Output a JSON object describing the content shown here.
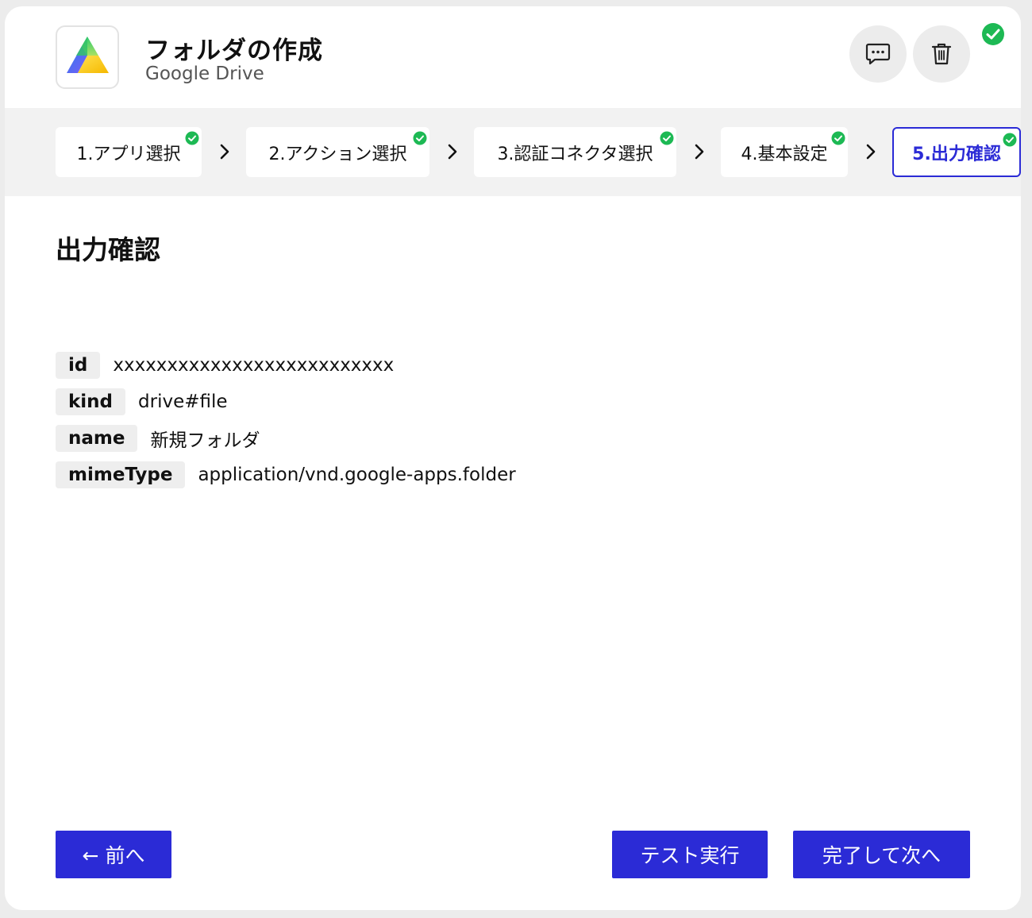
{
  "header": {
    "title": "フォルダの作成",
    "subtitle": "Google Drive",
    "logo_icon": "google-drive-logo",
    "comment_icon": "comment-icon",
    "trash_icon": "trash-icon",
    "status_icon": "check-circle-icon"
  },
  "colors": {
    "accent": "#2b2bd6",
    "success": "#1db954",
    "panel_bg": "#f2f2f2",
    "key_bg": "#eeeeee"
  },
  "steps": [
    {
      "label": "1.アプリ選択",
      "done": true
    },
    {
      "label": "2.アクション選択",
      "done": true
    },
    {
      "label": "3.認証コネクタ選択",
      "done": true
    },
    {
      "label": "4.基本設定",
      "done": true
    },
    {
      "label": "5.出力確認",
      "done": true,
      "active": true
    }
  ],
  "section": {
    "title": "出力確認"
  },
  "output": [
    {
      "key": "id",
      "value": "xxxxxxxxxxxxxxxxxxxxxxxxxx"
    },
    {
      "key": "kind",
      "value": "drive#file"
    },
    {
      "key": "name",
      "value": "新規フォルダ"
    },
    {
      "key": "mimeType",
      "value": "application/vnd.google-apps.folder"
    }
  ],
  "footer": {
    "prev_label": "← 前へ",
    "test_label": "テスト実行",
    "done_label": "完了して次へ"
  }
}
